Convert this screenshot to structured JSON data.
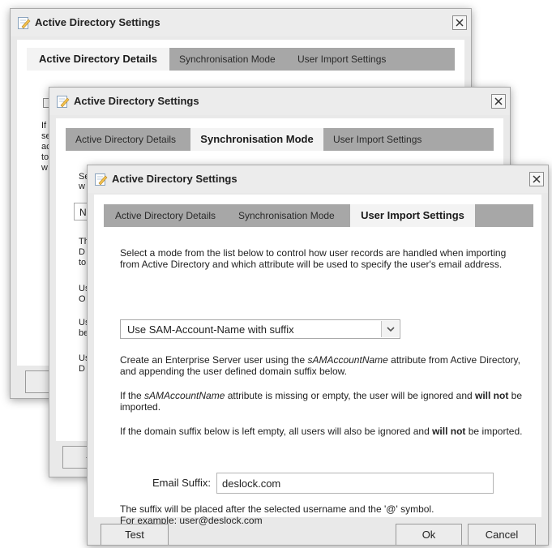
{
  "dialog_title": "Active Directory Settings",
  "tabs": {
    "details": "Active Directory Details",
    "sync": "Synchronisation Mode",
    "import": "User Import Settings"
  },
  "back_dialog": {
    "fragments": [
      "If",
      "se",
      "ac",
      "to",
      "w"
    ],
    "button_fragment": "-"
  },
  "middle_dialog": {
    "fragments": [
      "Se",
      "w",
      "N",
      "Th",
      "D",
      "to",
      "Us",
      "O",
      "Us",
      "be",
      "Us",
      "D"
    ],
    "button_fragment": "-"
  },
  "front_dialog": {
    "intro": "Select a mode from the list below to control how user records are handled when importing from Active Directory and which attribute will be used to specify the user's email address.",
    "mode_select": {
      "value": "Use SAM-Account-Name with suffix"
    },
    "desc": {
      "p1_a": "Create an Enterprise Server user using the ",
      "p1_em": "sAMAccountName",
      "p1_b": " attribute from Active Directory, and appending the user defined domain suffix below.",
      "p2_a": "If the ",
      "p2_em": "sAMAccountName",
      "p2_b": " attribute is missing or empty, the user will be ignored and ",
      "p2_strong": "will not",
      "p2_c": " be imported.",
      "p3_a": "If the domain suffix below is left empty, all users will also be ignored and ",
      "p3_strong": "will not",
      "p3_b": " be imported."
    },
    "email_suffix": {
      "label": "Email Suffix:",
      "value": "deslock.com"
    },
    "note_line1": "The suffix will be placed after the selected username and the '@' symbol.",
    "note_line2": "For example: user@deslock.com",
    "buttons": {
      "test": "Test",
      "ok": "Ok",
      "cancel": "Cancel"
    }
  },
  "icons": {
    "app": "settings-document-icon",
    "close": "close-icon",
    "dropdown": "chevron-down-icon"
  },
  "colors": {
    "tab_strip": "#a7a7a7",
    "active_tab": "#f3f3f3",
    "dialog_bg": "#e9e9e9",
    "panel_bg": "#ffffff"
  }
}
